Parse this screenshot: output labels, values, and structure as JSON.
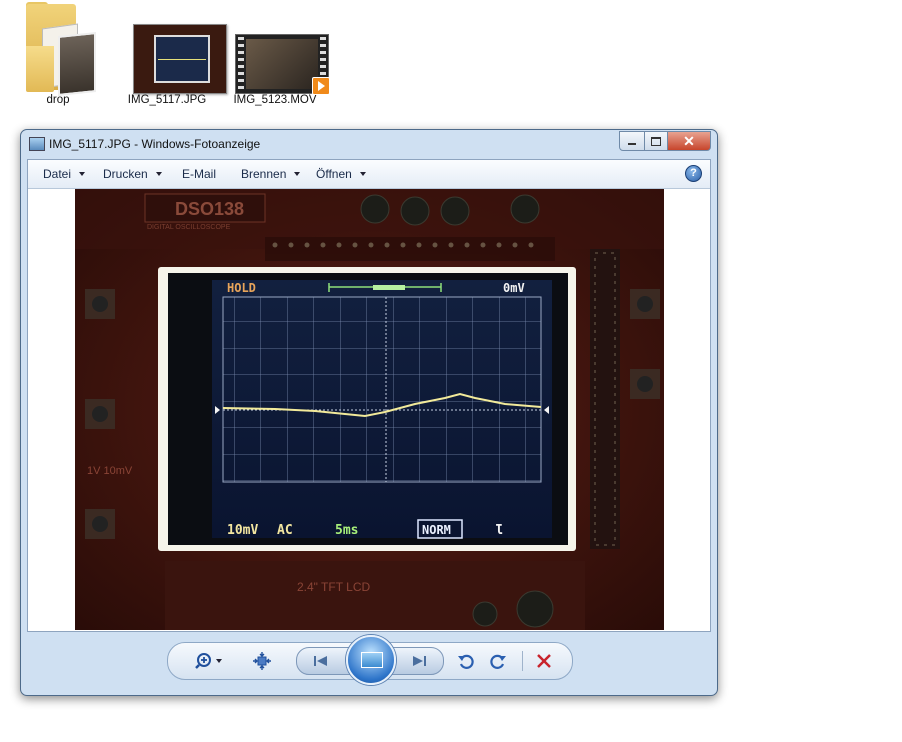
{
  "desktop": {
    "icons": [
      {
        "label": "drop"
      },
      {
        "label": "IMG_5117.JPG"
      },
      {
        "label": "IMG_5123.MOV"
      }
    ]
  },
  "window": {
    "title": "IMG_5117.JPG - Windows-Fotoanzeige",
    "menu": [
      "Datei",
      "Drucken",
      "E-Mail",
      "Brennen",
      "Öffnen"
    ],
    "help_icon": "?"
  },
  "photo": {
    "board_label": "DSO138",
    "board_sub": "DIGITAL OSCILLOSCOPE",
    "screen": {
      "status_left": "HOLD",
      "status_right": "0mV",
      "volts_div": "10mV",
      "coupling": "AC",
      "time_div": "5ms",
      "trigger_mode": "NORM",
      "trigger_slope": "Ɩ"
    },
    "pcb_text": [
      "2.4\" TFT LCD",
      "1V 10mV"
    ]
  },
  "toolbar": {
    "icons": [
      "zoom-icon",
      "fit-window-icon",
      "previous-icon",
      "slideshow-icon",
      "next-icon",
      "rotate-left-icon",
      "rotate-right-icon",
      "delete-icon"
    ],
    "colors": {
      "delete": "#c8232c",
      "rotate": "#2a5fb0",
      "accent": "#2d74c9"
    }
  }
}
